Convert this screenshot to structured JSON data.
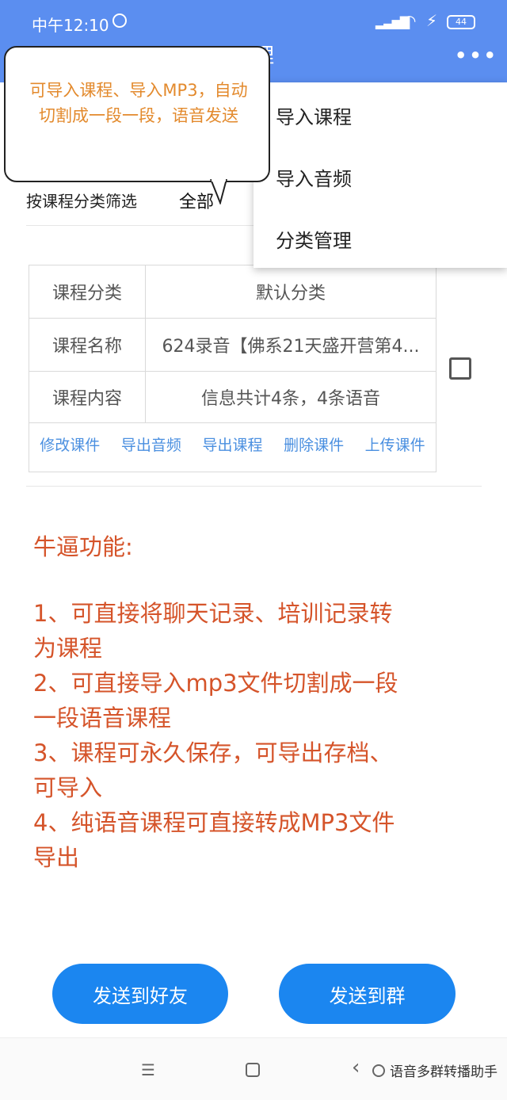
{
  "status_bar": {
    "time": "中午12:10",
    "battery": "44",
    "icons": [
      "alarm-icon",
      "signal-icon",
      "wifi-icon",
      "charging-icon",
      "battery-icon"
    ]
  },
  "header": {
    "title_fragment": "理",
    "more_label": "•••",
    "background_color": "#5b8ef0"
  },
  "dropdown_menu": {
    "items": [
      "导入课程",
      "导入音频",
      "分类管理"
    ]
  },
  "annotation_bubble": {
    "text": "可导入课程、导入MP3，自动切割成一段一段，语音发送"
  },
  "filter": {
    "label": "按课程分类筛选",
    "value": "全部"
  },
  "course_card": {
    "rows": [
      {
        "label": "课程分类",
        "value": "默认分类"
      },
      {
        "label": "课程名称",
        "value": "624录音【佛系21天盛开营第4..."
      },
      {
        "label": "课程内容",
        "value": "信息共计4条，4条语音"
      }
    ],
    "actions": [
      "修改课件",
      "导出音频",
      "导出课程",
      "删除课件",
      "上传课件"
    ],
    "action_color": "#4a8fe0"
  },
  "promo": {
    "heading": "牛逼功能:",
    "lines": [
      "1、可直接将聊天记录、培训记录转",
      "为课程",
      "2、可直接导入mp3文件切割成一段",
      "一段语音课程",
      "3、课程可永久保存，可导出存档、",
      "可导入",
      "4、纯语音课程可直接转成MP3文件",
      "导出"
    ],
    "color": "#d5542a"
  },
  "buttons": {
    "send_to_friend": "发送到好友",
    "send_to_group": "发送到群",
    "color": "#1b86f0"
  },
  "nav_bar": {
    "menu_icon": "☰",
    "back_icon": "‹",
    "watermark": "语音多群转播助手"
  }
}
